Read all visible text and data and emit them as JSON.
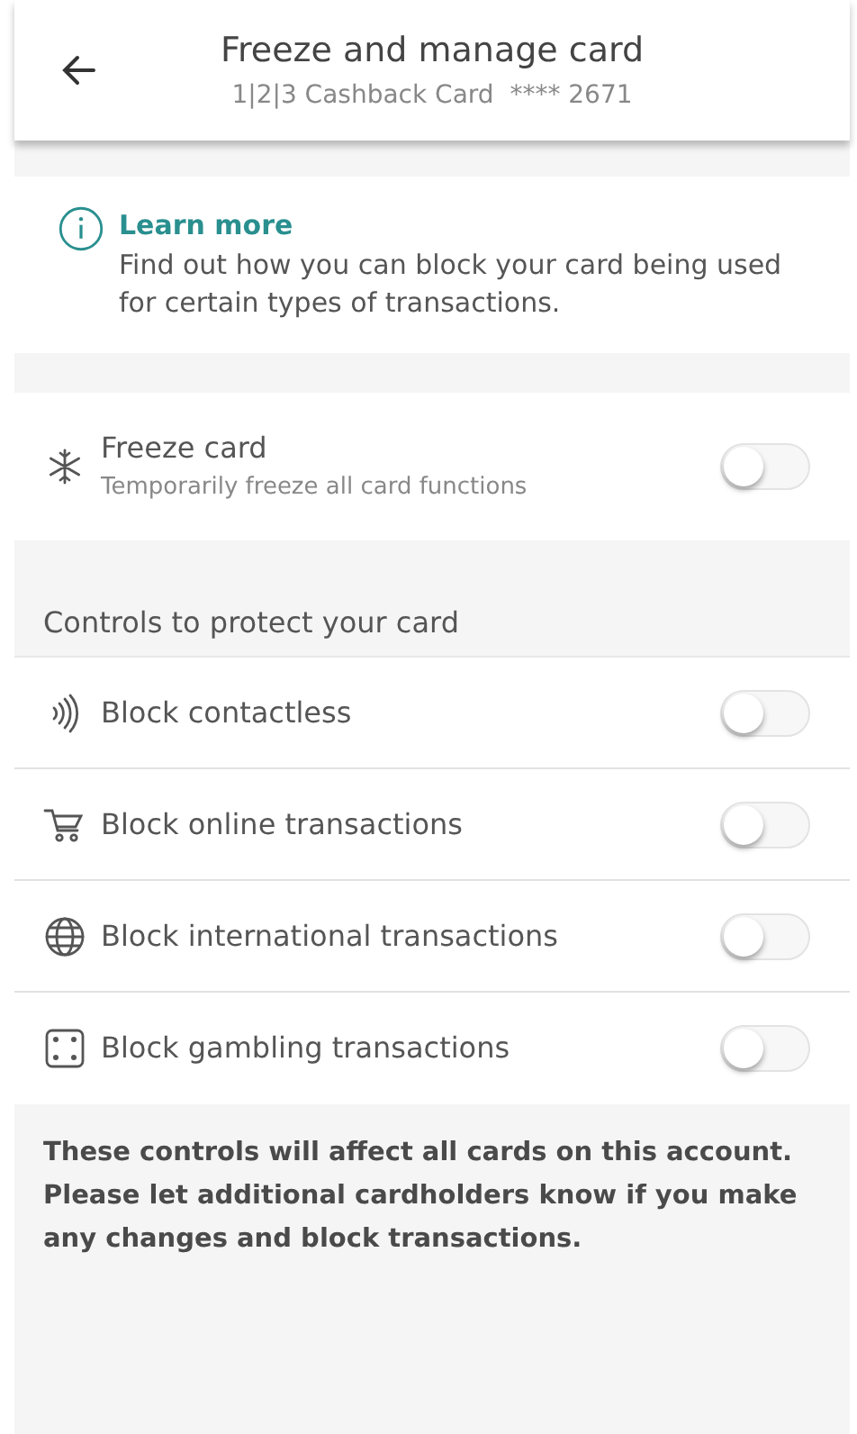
{
  "header": {
    "title": "Freeze and manage card",
    "subtitle": "1|2|3 Cashback Card  **** 2671"
  },
  "info": {
    "link": "Learn more",
    "text": "Find out how you can block your card being used for certain types of transactions."
  },
  "freeze": {
    "label": "Freeze card",
    "description": "Temporarily freeze all card functions",
    "on": false
  },
  "controls_heading": "Controls to protect your card",
  "controls": [
    {
      "kind": "contactless",
      "label": "Block contactless",
      "on": false
    },
    {
      "kind": "online",
      "label": "Block online transactions",
      "on": false
    },
    {
      "kind": "international",
      "label": "Block international transactions",
      "on": false
    },
    {
      "kind": "gambling",
      "label": "Block gambling transactions",
      "on": false
    }
  ],
  "footer_note": "These controls will affect all cards on this account. Please let additional cardholders know if you make any changes and block transactions."
}
